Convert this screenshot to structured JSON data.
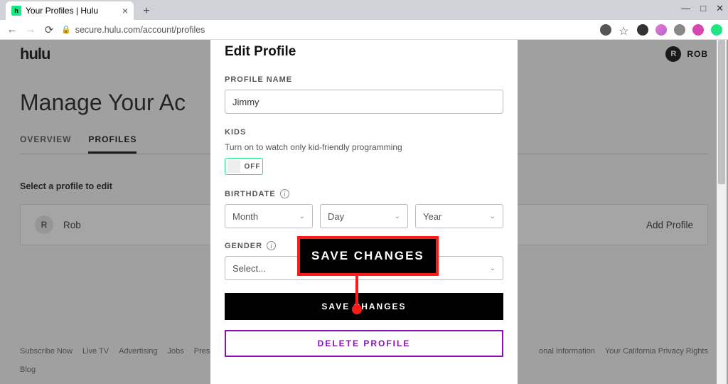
{
  "browser": {
    "tab_title": "Your Profiles | Hulu",
    "url": "secure.hulu.com/account/profiles"
  },
  "header": {
    "logo": "hulu",
    "user_initial": "R",
    "user_name": "ROB"
  },
  "page": {
    "title": "Manage Your Ac",
    "tabs": {
      "overview": "OVERVIEW",
      "profiles": "PROFILES"
    },
    "select_label": "Select a profile to edit",
    "profile_initial": "R",
    "profile_name": "Rob",
    "add_profile": "Add Profile"
  },
  "footer": {
    "links": [
      "Subscribe Now",
      "Live TV",
      "Advertising",
      "Jobs",
      "Press",
      "onal Information",
      "Your California Privacy Rights",
      "Blog"
    ]
  },
  "modal": {
    "title": "Edit Profile",
    "name_label": "PROFILE NAME",
    "name_value": "Jimmy",
    "kids_label": "KIDS",
    "kids_help": "Turn on to watch only kid-friendly programming",
    "kids_state": "OFF",
    "birthdate_label": "BIRTHDATE",
    "month": "Month",
    "day": "Day",
    "year": "Year",
    "gender_label": "GENDER",
    "gender_value": "Select...",
    "save": "SAVE CHANGES",
    "delete": "DELETE PROFILE"
  },
  "callout": {
    "text": "SAVE CHANGES"
  }
}
